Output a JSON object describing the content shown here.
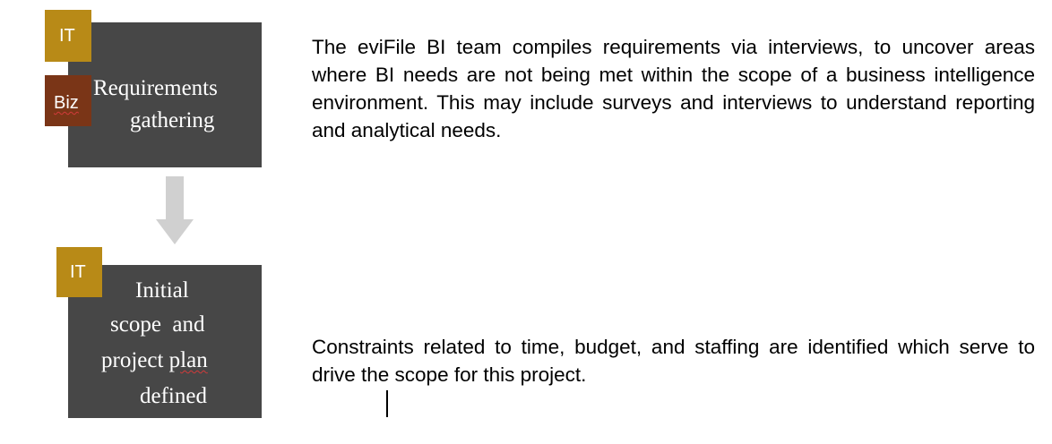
{
  "steps": [
    {
      "lines": [
        "Requirements",
        "gathering"
      ],
      "tags": [
        "IT",
        "Biz"
      ]
    },
    {
      "lines": [
        "Initial",
        "scope  and",
        "project p",
        "lan",
        "defined"
      ],
      "tags": [
        "IT"
      ]
    }
  ],
  "descriptions": [
    "The eviFile BI team compiles requirements via interviews, to uncover areas where BI needs are not being met within the scope of a business intelligence environment. This may include surveys and interviews to understand reporting and analytical needs.",
    "Constraints related to time, budget, and staffing are identified which serve to drive the scope for this project."
  ],
  "colors": {
    "box": "#474747",
    "tag_it": "#b88a17",
    "tag_biz": "#7a3517",
    "arrow": "#d0d0d0"
  }
}
